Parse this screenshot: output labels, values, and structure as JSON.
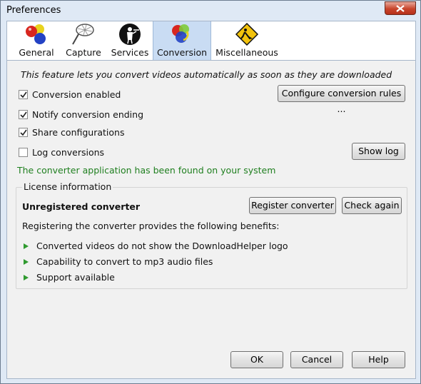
{
  "window": {
    "title": "Preferences"
  },
  "tabs": [
    {
      "label": "General",
      "icon": "rgb-balls-icon"
    },
    {
      "label": "Capture",
      "icon": "net-icon"
    },
    {
      "label": "Services",
      "icon": "waiter-icon"
    },
    {
      "label": "Conversion",
      "icon": "conversion-balls-icon"
    },
    {
      "label": "Miscellaneous",
      "icon": "road-works-icon"
    }
  ],
  "active_tab": "Conversion",
  "conversion": {
    "note": "This feature lets you convert videos automatically as soon as they are downloaded",
    "options": [
      {
        "label": "Conversion enabled",
        "checked": true
      },
      {
        "label": "Notify conversion ending",
        "checked": true
      },
      {
        "label": "Share configurations",
        "checked": true
      },
      {
        "label": "Log conversions",
        "checked": false
      }
    ],
    "configure_button": "Configure conversion rules ...",
    "show_log_button": "Show log",
    "found_message": "The converter application has been found on your system"
  },
  "license": {
    "group_title": "License information",
    "status": "Unregistered converter",
    "register_button": "Register converter",
    "check_button": "Check again",
    "intro": "Registering the converter provides the following benefits:",
    "benefits": [
      "Converted videos do not show the DownloadHelper logo",
      "Capability to convert to mp3 audio files",
      "Support available"
    ]
  },
  "footer": {
    "ok": "OK",
    "cancel": "Cancel",
    "help": "Help"
  },
  "colors": {
    "found_text": "#1f7f1f",
    "bullet": "#2f9a2f",
    "active_tab": "#c9dcf3"
  }
}
